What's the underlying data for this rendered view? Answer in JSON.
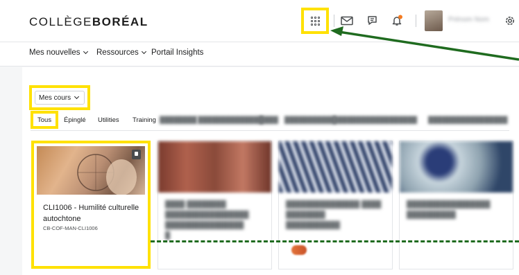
{
  "header": {
    "logo_light": "COLLÈGE",
    "logo_bold": "BORÉAL",
    "icons": [
      "apps-waffle-icon",
      "mail-icon",
      "chat-icon",
      "bell-icon",
      "settings-icon"
    ],
    "notification_color": "#f47b20"
  },
  "nav": {
    "items": [
      {
        "label": "Mes nouvelles",
        "has_dropdown": true
      },
      {
        "label": "Ressources",
        "has_dropdown": true
      },
      {
        "label": "Portail Insights",
        "has_dropdown": false
      }
    ]
  },
  "courses": {
    "dropdown_label": "Mes cours",
    "tabs": [
      "Tous",
      "Épinglé",
      "Utilities",
      "Training"
    ],
    "cards": [
      {
        "title": "CLI1006 - Humilité culturelle autochtone",
        "code": "CB-COF-MAN-CLI1006",
        "pinned": true
      }
    ]
  },
  "annotation": {
    "highlight_color": "#ffe100",
    "arrow_color": "#1f6b1f"
  }
}
